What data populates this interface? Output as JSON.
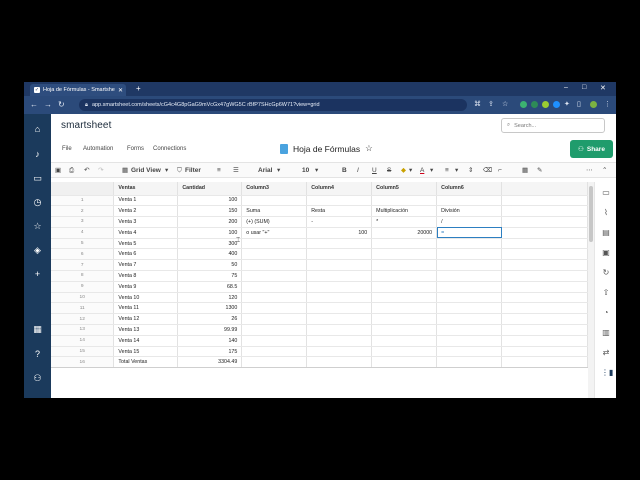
{
  "browser": {
    "tab_title": "Hoja de Fórmulas - Smartsheet.c",
    "tab_favicon": "✓",
    "url": "app.smartsheet.com/sheets/cG4c4G8pGaG9mVcGx47gWG5C rBfP7SHcGp6W71?view=grid",
    "controls": {
      "minimize": "–",
      "maximize": "□",
      "close": "✕"
    }
  },
  "app": {
    "logo": "smartsheet",
    "search_placeholder": "Search...",
    "menu": {
      "file": "File",
      "automation": "Automation",
      "forms": "Forms",
      "connections": "Connections"
    },
    "sheet_title": "Hoja de Fórmulas",
    "share_label": "Share"
  },
  "toolbar": {
    "view_label": "Grid View",
    "filter_label": "Filter",
    "font_name": "Arial",
    "font_size": "10"
  },
  "grid": {
    "columns": [
      "Ventas",
      "Cantidad",
      "Column3",
      "Column4",
      "Column5",
      "Column6"
    ],
    "rows": [
      [
        "1",
        "Venta 1",
        "100",
        "",
        "",
        "",
        ""
      ],
      [
        "2",
        "Venta 2",
        "150",
        "Suma",
        "Resta",
        "Multiplicación",
        "División"
      ],
      [
        "3",
        "Venta 3",
        "200",
        "(+) (SUM)",
        "-",
        "*",
        "/"
      ],
      [
        "4",
        "Venta 4",
        "100",
        "o usar \"+\"",
        "100",
        "20000",
        "="
      ],
      [
        "5",
        "Venta 5",
        "300",
        "",
        "",
        "",
        ""
      ],
      [
        "6",
        "Venta 6",
        "400",
        "",
        "",
        "",
        ""
      ],
      [
        "7",
        "Venta 7",
        "50",
        "",
        "",
        "",
        ""
      ],
      [
        "8",
        "Venta 8",
        "75",
        "",
        "",
        "",
        ""
      ],
      [
        "9",
        "Venta 9",
        "68.5",
        "",
        "",
        "",
        ""
      ],
      [
        "10",
        "Venta 10",
        "120",
        "",
        "",
        "",
        ""
      ],
      [
        "11",
        "Venta 11",
        "1300",
        "",
        "",
        "",
        ""
      ],
      [
        "12",
        "Venta 12",
        "26",
        "",
        "",
        "",
        ""
      ],
      [
        "13",
        "Venta 13",
        "99.99",
        "",
        "",
        "",
        ""
      ],
      [
        "14",
        "Venta 14",
        "140",
        "",
        "",
        "",
        ""
      ],
      [
        "15",
        "Venta 15",
        "175",
        "",
        "",
        "",
        ""
      ],
      [
        "16",
        "Total Ventas",
        "3304.49",
        "",
        "",
        "",
        ""
      ]
    ]
  }
}
